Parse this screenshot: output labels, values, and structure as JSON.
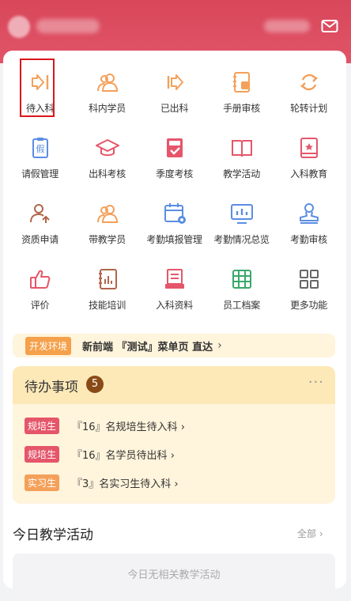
{
  "header": {
    "mail_icon": "mail-icon"
  },
  "grid": [
    {
      "label": "待入科",
      "icon": "enter-department-icon"
    },
    {
      "label": "科内学员",
      "icon": "students-icon"
    },
    {
      "label": "已出科",
      "icon": "exit-department-icon"
    },
    {
      "label": "手册审核",
      "icon": "handbook-review-icon"
    },
    {
      "label": "轮转计划",
      "icon": "rotation-plan-icon"
    },
    {
      "label": "请假管理",
      "icon": "leave-management-icon"
    },
    {
      "label": "出科考核",
      "icon": "graduation-cap-icon"
    },
    {
      "label": "季度考核",
      "icon": "quarterly-assessment-icon"
    },
    {
      "label": "教学活动",
      "icon": "book-icon"
    },
    {
      "label": "入科教育",
      "icon": "entry-education-icon"
    },
    {
      "label": "资质申请",
      "icon": "qualification-icon"
    },
    {
      "label": "带教学员",
      "icon": "teaching-students-icon"
    },
    {
      "label": "考勤填报管理",
      "icon": "attendance-calendar-icon"
    },
    {
      "label": "考勤情况总览",
      "icon": "attendance-overview-icon"
    },
    {
      "label": "考勤审核",
      "icon": "attendance-review-icon"
    },
    {
      "label": "评价",
      "icon": "thumbs-up-icon"
    },
    {
      "label": "技能培训",
      "icon": "skills-training-icon"
    },
    {
      "label": "入科资料",
      "icon": "entry-materials-icon"
    },
    {
      "label": "员工档案",
      "icon": "staff-archive-icon"
    },
    {
      "label": "更多功能",
      "icon": "more-grid-icon"
    }
  ],
  "dev": {
    "tag": "开发环境",
    "text": "新前端 『测试』菜单页 直达",
    "chevron": "›"
  },
  "todo": {
    "title": "待办事项",
    "count": "5",
    "more": "···",
    "items": [
      {
        "tag": "规培生",
        "text": "『16』名规培生待入科 ›",
        "color": "#e5566a"
      },
      {
        "tag": "规培生",
        "text": "『16』名学员待出科 ›",
        "color": "#e5566a"
      },
      {
        "tag": "实习生",
        "text": "『3』名实习生待入科 ›",
        "color": "#f4a05a"
      }
    ]
  },
  "today": {
    "title": "今日教学活动",
    "all": "全部 ›",
    "empty": "今日无相关教学活动"
  },
  "colors": {
    "header": "#d8475a",
    "accent_orange": "#f5a04a",
    "accent_red": "#e5566a",
    "todo_bg": "#fff4dc"
  }
}
